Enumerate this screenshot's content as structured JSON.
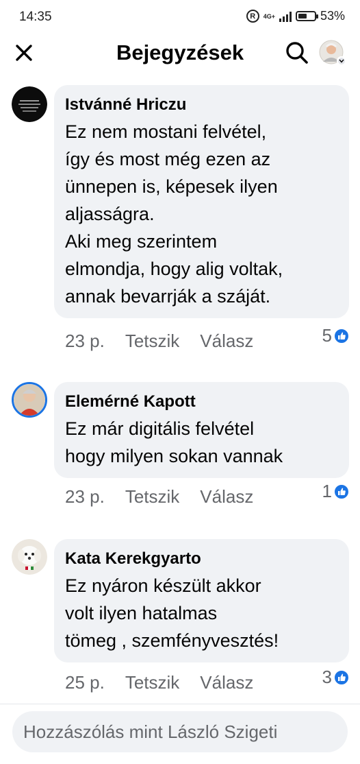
{
  "status_bar": {
    "time": "14:35",
    "network": "4G+",
    "battery_percent": "53%",
    "battery_level": 0.53
  },
  "header": {
    "title": "Bejegyzések",
    "close_icon": "close-icon",
    "search_icon": "search-icon"
  },
  "comments": [
    {
      "author": "Istvánné Hriczu",
      "text": "Ez nem mostani felvétel,\nígy és most még ezen az\nünnepen is, képesek ilyen\naljasságra.\nAki meg szerintem\nelmondja, hogy alig voltak,\nannak bevarrják a száját.",
      "time": "23 p.",
      "like_label": "Tetszik",
      "reply_label": "Válasz",
      "reaction_count": "5"
    },
    {
      "author": "Elemérné Kapott",
      "text": "Ez már digitális felvétel\nhogy milyen sokan vannak",
      "time": "23 p.",
      "like_label": "Tetszik",
      "reply_label": "Válasz",
      "reaction_count": "1"
    },
    {
      "author": "Kata Kerekgyarto",
      "text": "Ez nyáron készült akkor\nvolt ilyen hatalmas\ntömeg , szemfényvesztés!",
      "time": "25 p.",
      "like_label": "Tetszik",
      "reply_label": "Válasz",
      "reaction_count": "3"
    }
  ],
  "composer": {
    "placeholder": "Hozzászólás mint László Szigeti"
  },
  "colors": {
    "bubble": "#f0f2f5",
    "meta_text": "#65676b",
    "like_blue": "#1b74e4"
  }
}
